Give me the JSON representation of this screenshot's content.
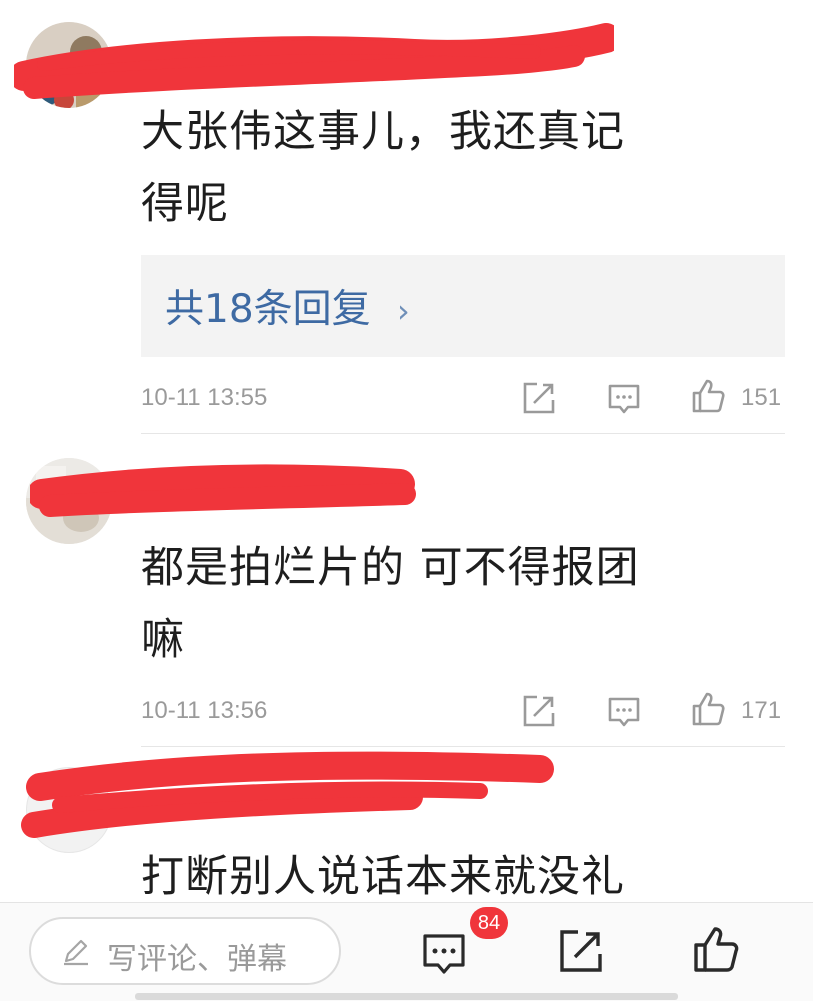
{
  "comments": [
    {
      "text_line1": "大张伟这事儿，我还真记",
      "text_line2": "得呢",
      "replies_label": "共18条回复",
      "replies_chevron": "›",
      "time": "10-11 13:55",
      "likes": "151"
    },
    {
      "text_line1": "都是拍烂片的 可不得报团",
      "text_line2": "嘛",
      "time": "10-11 13:56",
      "likes": "171"
    },
    {
      "text_line1": "打断别人说话本来就没礼"
    }
  ],
  "bottom_bar": {
    "input_placeholder": "写评论、弹幕",
    "comment_badge": "84"
  },
  "colors": {
    "accent_link": "#3e6aa3",
    "badge_red": "#f0353b",
    "redaction_red": "#f0353b"
  },
  "icons": [
    "share-icon",
    "danmaku-icon",
    "thumb-up-icon",
    "pencil-icon"
  ]
}
